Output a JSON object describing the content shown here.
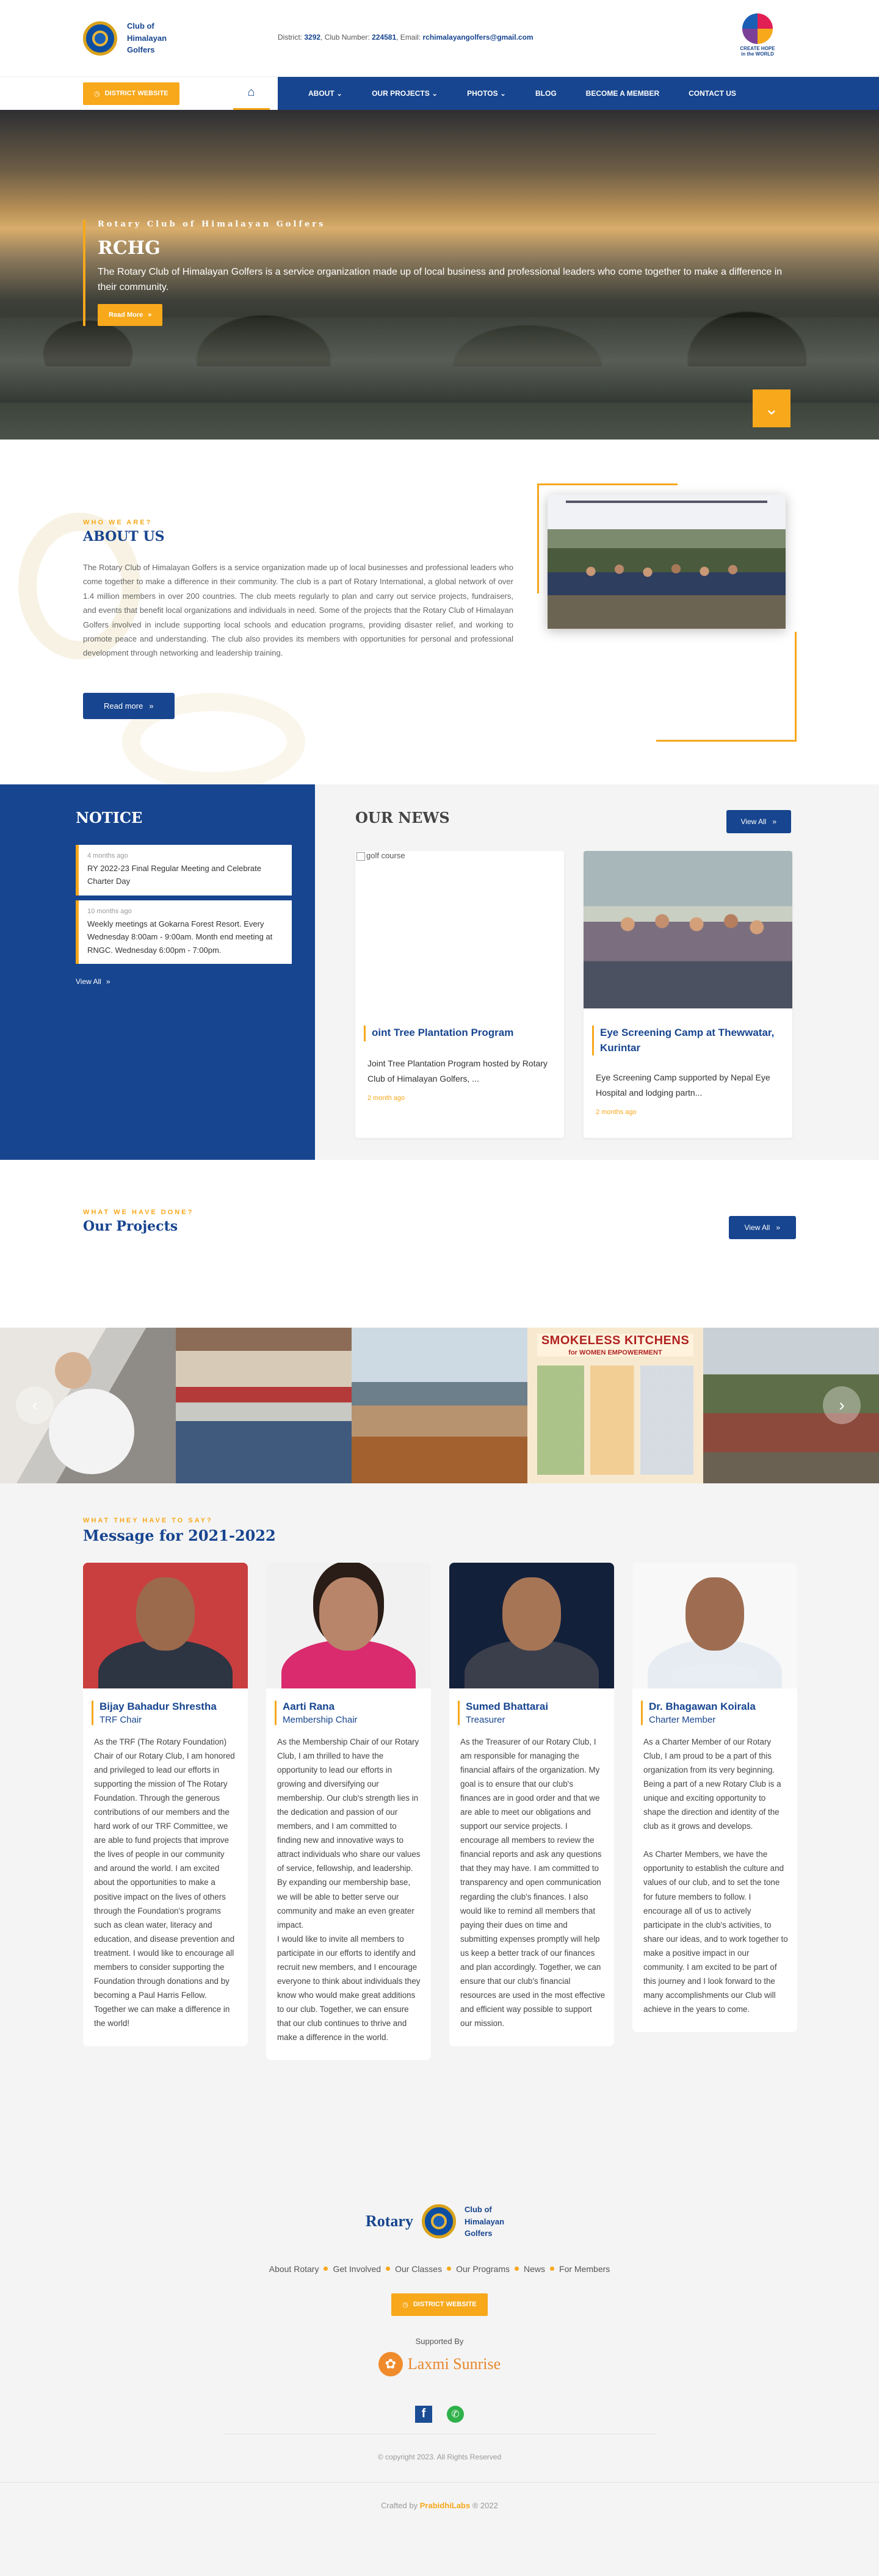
{
  "header": {
    "club_name": "Club of Himalayan Golfers",
    "contact_district_label": "District:",
    "contact_district": "3292",
    "contact_club_label": ", Club Number:",
    "contact_club": "224581",
    "contact_email_label": ", Email:",
    "contact_email": "rchimalayangolfers@gmail.com",
    "cause_text": "CREATE HOPE in the WORLD"
  },
  "nav": {
    "district_button": "DISTRICT WEBSITE",
    "items": [
      "ABOUT",
      "OUR PROJECTS",
      "PHOTOS",
      "BLOG",
      "BECOME A MEMBER",
      "CONTACT US"
    ]
  },
  "hero": {
    "kicker": "Rotary Club of Himalayan Golfers",
    "title": "RCHG",
    "text": "The Rotary Club of Himalayan Golfers is a service organization made up of local business and professional leaders who come together to make a difference in their community.",
    "button": "Read More"
  },
  "about": {
    "eyebrow": "WHO WE ARE?",
    "title": "ABOUT US",
    "paragraph": "The Rotary Club of Himalayan Golfers is a service organization made up of local businesses and professional leaders who come together to make a difference in their community. The club is a part of Rotary International, a global network of over 1.4 million members in over 200 countries. The club meets regularly to plan and carry out service projects, fundraisers, and events that benefit local organizations and individuals in need. Some of the projects that the Rotary Club of Himalayan Golfers involved in include supporting local schools and education programs, providing disaster relief, and working to promote peace and understanding. The club also provides its members with opportunities for personal and professional development through networking and leadership training.",
    "button": "Read more"
  },
  "notice": {
    "title": "NOTICE",
    "items": [
      {
        "time": "4 months ago",
        "text": "RY 2022-23 Final Regular Meeting and Celebrate Charter Day"
      },
      {
        "time": "10 months ago",
        "text": "Weekly meetings at Gokarna Forest Resort. Every Wednesday 8:00am - 9:00am. Month end meeting at RNGC. Wednesday 6:00pm - 7:00pm."
      }
    ],
    "view_all": "View All"
  },
  "news": {
    "title": "OUR NEWS",
    "view_all": "View All",
    "items": [
      {
        "img_alt": "golf course",
        "title": "oint Tree Plantation Program",
        "desc": "Joint Tree Plantation Program hosted by Rotary Club of Himalayan Golfers, ...",
        "date": "2 month ago"
      },
      {
        "img_alt": "",
        "title": "Eye Screening Camp at Thewwatar, Kurintar",
        "desc": "Eye Screening Camp supported by Nepal Eye Hospital and lodging partn...",
        "date": "2 months ago"
      }
    ]
  },
  "projects": {
    "eyebrow": "WHAT WE HAVE DONE?",
    "title": "Our Projects",
    "view_all": "View All",
    "poster_title": "SMOKELESS KITCHENS",
    "poster_subtitle": "for WOMEN EMPOWERMENT"
  },
  "messages": {
    "eyebrow": "WHAT THEY HAVE TO SAY?",
    "title": "Message for 2021-2022",
    "items": [
      {
        "name": "Bijay Bahadur Shrestha",
        "role": "TRF Chair",
        "text": "As the TRF (The Rotary Foundation) Chair of our Rotary Club, I am honored and privileged to lead our efforts in supporting the mission of The Rotary Foundation. Through the generous contributions of our members and the hard work of our TRF Committee, we are able to fund projects that improve the lives of people in our community and around the world. I am excited about the opportunities to make a positive impact on the lives of others through the Foundation's programs such as clean water, literacy and education, and disease prevention and treatment. I would like to encourage all members to consider supporting the Foundation through donations and by becoming a Paul Harris Fellow. Together we can make a difference in the world!"
      },
      {
        "name": "Aarti Rana",
        "role": "Membership Chair",
        "text": "As the Membership Chair of our Rotary Club, I am thrilled to have the opportunity to lead our efforts in growing and diversifying our membership. Our club's strength lies in the dedication and passion of our members, and I am committed to finding new and innovative ways to attract individuals who share our values of service, fellowship, and leadership. By expanding our membership base, we will be able to better serve our community and make an even greater impact.\nI would like to invite all members to participate in our efforts to identify and recruit new members, and I encourage everyone to think about individuals they know who would make great additions to our club. Together, we can ensure that our club continues to thrive and make a difference in the world."
      },
      {
        "name": "Sumed Bhattarai",
        "role": "Treasurer",
        "text": "As the Treasurer of our Rotary Club, I am responsible for managing the financial affairs of the organization. My goal is to ensure that our club's finances are in good order and that we are able to meet our obligations and support our service projects. I encourage all members to review the financial reports and ask any questions that they may have. I am committed to transparency and open communication regarding the club's finances. I also would like to remind all members that paying their dues on time and submitting expenses promptly will help us keep a better track of our finances and plan accordingly. Together, we can ensure that our club's financial resources are used in the most effective and efficient way possible to support our mission."
      },
      {
        "name": "Dr. Bhagawan Koirala",
        "role": "Charter Member",
        "text": "As a Charter Member of our Rotary Club, I am proud to be a part of this organization from its very beginning. Being a part of a new Rotary Club is a unique and exciting opportunity to shape the direction and identity of the club as it grows and develops.\n\nAs Charter Members, we have the opportunity to establish the culture and values of our club, and to set the tone for future members to follow. I encourage all of us to actively participate in the club's activities, to share our ideas, and to work together to make a positive impact in our community. I am excited to be part of this journey and I look forward to the many accomplishments our Club will achieve in the years to come."
      }
    ]
  },
  "footer": {
    "rotary_word": "Rotary",
    "club_name": "Club of Himalayan Golfers",
    "links": [
      "About Rotary",
      "Get Involved",
      "Our Classes",
      "Our Programs",
      "News",
      "For Members"
    ],
    "district_button": "DISTRICT WEBSITE",
    "supported_by": "Supported By",
    "sponsor": "Laxmi Sunrise",
    "copyright": "© copyright 2023. All Rights Reserved",
    "crafted_prefix": "Crafted by",
    "crafted_by": "PrabidhiLabs",
    "crafted_suffix": "® 2022"
  },
  "colors": {
    "primary": "#17458f",
    "accent": "#f7a81b",
    "background": "#f4f4f4"
  }
}
